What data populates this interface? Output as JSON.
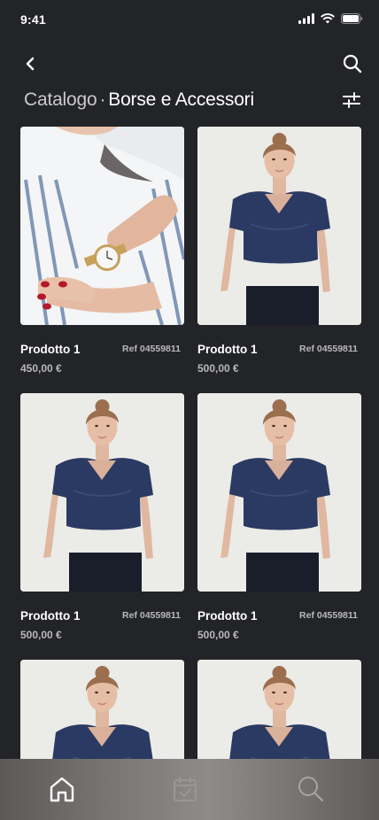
{
  "status": {
    "time": "9:41"
  },
  "header": {
    "title_category": "Catalogo",
    "title_separator": "·",
    "title_subcategory": "Borse e Accessori"
  },
  "products": [
    {
      "name": "Prodotto 1",
      "ref": "Ref 04559811",
      "price": "450,00 €",
      "image": "watch-wrist"
    },
    {
      "name": "Prodotto 1",
      "ref": "Ref 04559811",
      "price": "500,00 €",
      "image": "model-navy-top"
    },
    {
      "name": "Prodotto 1",
      "ref": "Ref 04559811",
      "price": "500,00 €",
      "image": "model-navy-top"
    },
    {
      "name": "Prodotto 1",
      "ref": "Ref 04559811",
      "price": "500,00 €",
      "image": "model-navy-top"
    },
    {
      "name": "",
      "ref": "",
      "price": "",
      "image": "model-navy-top"
    },
    {
      "name": "",
      "ref": "",
      "price": "",
      "image": "model-navy-top"
    }
  ],
  "tab_bar": {
    "items": [
      "home-icon",
      "calendar-check-icon",
      "search-icon"
    ],
    "active": "home-icon"
  }
}
